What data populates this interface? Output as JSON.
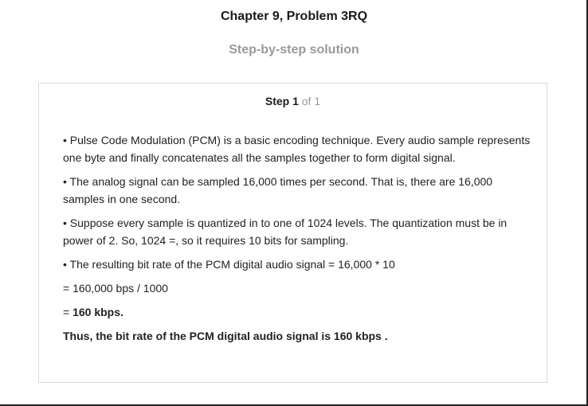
{
  "header": {
    "title": "Chapter 9, Problem 3RQ",
    "subtitle": "Step-by-step solution"
  },
  "step": {
    "label": "Step 1",
    "of": "of 1"
  },
  "content": {
    "bullets": [
      "• Pulse Code Modulation (PCM) is a basic encoding technique. Every audio sample represents one byte and finally concatenates all the samples together to form digital signal.",
      "• The analog signal can be sampled 16,000 times per second. That is, there are 16,000 samples in one second.",
      "• Suppose every sample is quantized in to one of 1024 levels. The quantization must be in power of 2. So, 1024 =, so it requires 10 bits for sampling.",
      "• The resulting bit rate of the PCM digital audio signal = 16,000 * 10"
    ],
    "calc_line": "= 160,000 bps / 1000",
    "result_prefix": "= ",
    "result_value": "160 kbps.",
    "conclusion": "Thus, the bit rate of the PCM digital audio signal is 160 kbps ."
  }
}
